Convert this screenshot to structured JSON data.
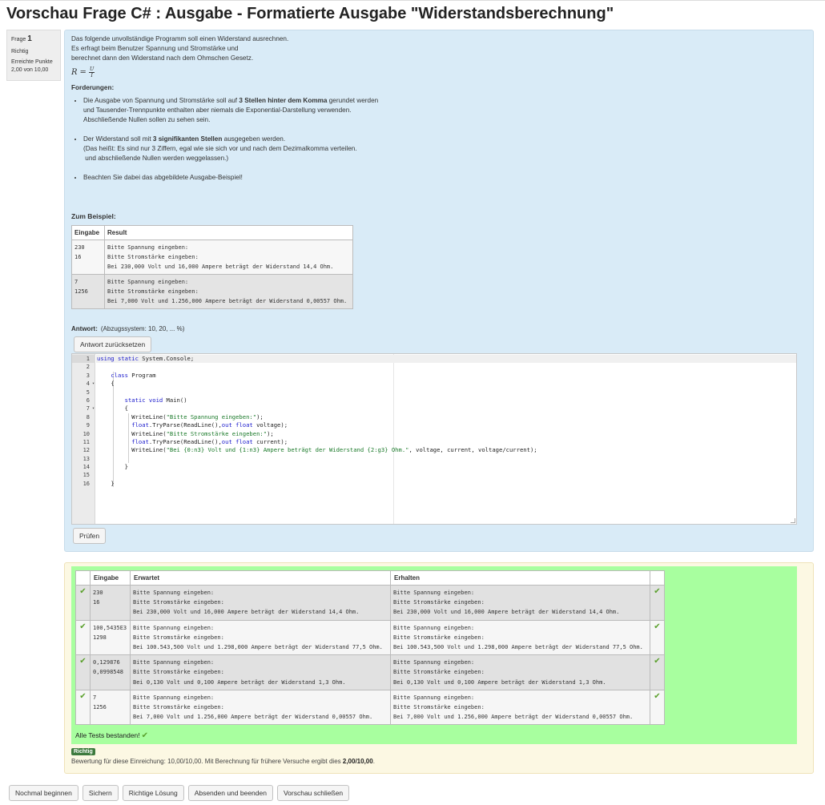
{
  "page": {
    "title": "Vorschau Frage C# : Ausgabe - Formatierte Ausgabe \"Widerstandsberechnung\""
  },
  "info": {
    "question_label": "Frage",
    "question_number": "1",
    "state": "Richtig",
    "points_label": "Erreichte Punkte",
    "points": "2,00 von 10,00"
  },
  "question": {
    "intro": [
      "Das folgende unvollständige Programm soll einen Widerstand ausrechnen.",
      "Es erfragt beim Benutzer Spannung und Stromstärke und",
      "berechnet dann den Widerstand nach dem Ohmschen Gesetz."
    ],
    "formula": {
      "lhs": "R",
      "eq": "=",
      "num": "U",
      "den": "I"
    },
    "requirements_title": "Forderungen:",
    "req1": {
      "a": "Die Ausgabe von Spannung und Stromstärke soll auf ",
      "b": "3 Stellen hinter dem Komma",
      "c": " gerundet werden",
      "l2": "und Tausender-Trennpunkte enthalten aber niemals die Exponential-Darstellung verwenden.",
      "l3": "Abschließende Nullen sollen zu sehen sein."
    },
    "req2": {
      "a": "Der Widerstand soll mit ",
      "b": "3 signifikanten Stellen",
      "c": " ausgegeben werden.",
      "l2": "(Das heißt: Es sind nur 3 Ziffern, egal wie sie sich vor und nach dem Dezimalkomma verteilen.",
      "l3": " und abschließende Nullen werden weggelassen.)"
    },
    "req3": "Beachten Sie dabei das abgebildete Ausgabe-Beispiel!",
    "example_title": "Zum Beispiel:",
    "example_headers": [
      "Eingabe",
      "Result"
    ],
    "examples": [
      {
        "input": "230\n16",
        "result": "Bitte Spannung eingeben:\nBitte Stromstärke eingeben:\nBei 230,000 Volt und 16,000 Ampere beträgt der Widerstand 14,4 Ohm."
      },
      {
        "input": "7\n1256",
        "result": "Bitte Spannung eingeben:\nBitte Stromstärke eingeben:\nBei 7,000 Volt und 1.256,000 Ampere beträgt der Widerstand 0,00557 Ohm."
      }
    ]
  },
  "answer": {
    "label": "Antwort:",
    "penalty": "(Abzugssystem: 10, 20, ... %)",
    "reset_label": "Antwort zurücksetzen",
    "check_label": "Prüfen",
    "line_numbers": [
      "1",
      "2",
      "3",
      "4",
      "5",
      "6",
      "7",
      "8",
      "9",
      "10",
      "11",
      "12",
      "13",
      "14",
      "15",
      "16"
    ],
    "code": {
      "l1_kw": "using static",
      "l1_rest": " System.Console;",
      "l3_kw": "class",
      "l3_rest": " Program",
      "l4": "{",
      "l6_kw": "static void",
      "l6_rest": " Main()",
      "l7": "{",
      "l8_a": "WriteLine(",
      "l8_s": "\"Bitte Spannung eingeben:\"",
      "l8_b": ");",
      "l9_kw1": "float",
      "l9_a": ".TryParse(ReadLine(),",
      "l9_kw2": "out float",
      "l9_b": " voltage);",
      "l10_a": "WriteLine(",
      "l10_s": "\"Bitte Stromstärke eingeben:\"",
      "l10_b": ");",
      "l11_kw1": "float",
      "l11_a": ".TryParse(ReadLine(),",
      "l11_kw2": "out float",
      "l11_b": " current);",
      "l12_a": "WriteLine(",
      "l12_s": "\"Bei {0:n3} Volt und {1:n3} Ampere beträgt der Widerstand {2:g3} Ohm.\"",
      "l12_b": ", voltage, current, voltage/current);",
      "l14": "}",
      "l16": "}"
    }
  },
  "feedback": {
    "headers": [
      "Eingabe",
      "Erwartet",
      "Erhalten"
    ],
    "tick": "✔",
    "rows": [
      {
        "input": "230\n16",
        "expected": "Bitte Spannung eingeben:\nBitte Stromstärke eingeben:\nBei 230,000 Volt und 16,000 Ampere beträgt der Widerstand 14,4 Ohm.",
        "got": "Bitte Spannung eingeben:\nBitte Stromstärke eingeben:\nBei 230,000 Volt und 16,000 Ampere beträgt der Widerstand 14,4 Ohm."
      },
      {
        "input": "100,5435E3\n1298",
        "expected": "Bitte Spannung eingeben:\nBitte Stromstärke eingeben:\nBei 100.543,500 Volt und 1.298,000 Ampere beträgt der Widerstand 77,5 Ohm.",
        "got": "Bitte Spannung eingeben:\nBitte Stromstärke eingeben:\nBei 100.543,500 Volt und 1.298,000 Ampere beträgt der Widerstand 77,5 Ohm."
      },
      {
        "input": "0,129876\n0,0998548",
        "expected": "Bitte Spannung eingeben:\nBitte Stromstärke eingeben:\nBei 0,130 Volt und 0,100 Ampere beträgt der Widerstand 1,3 Ohm.",
        "got": "Bitte Spannung eingeben:\nBitte Stromstärke eingeben:\nBei 0,130 Volt und 0,100 Ampere beträgt der Widerstand 1,3 Ohm."
      },
      {
        "input": "7\n1256",
        "expected": "Bitte Spannung eingeben:\nBitte Stromstärke eingeben:\nBei 7,000 Volt und 1.256,000 Ampere beträgt der Widerstand 0,00557 Ohm.",
        "got": "Bitte Spannung eingeben:\nBitte Stromstärke eingeben:\nBei 7,000 Volt und 1.256,000 Ampere beträgt der Widerstand 0,00557 Ohm."
      }
    ],
    "all_passed": "Alle Tests bestanden!",
    "badge": "Richtig",
    "grade_text": "Bewertung für diese Einreichung: 10,00/10,00. Mit Berechnung für frühere Versuche ergibt dies ",
    "grade_final": "2,00/10,00",
    "grade_end": "."
  },
  "buttons": {
    "restart": "Nochmal beginnen",
    "save": "Sichern",
    "solution": "Richtige Lösung",
    "submit": "Absenden und beenden",
    "close": "Vorschau schließen"
  }
}
